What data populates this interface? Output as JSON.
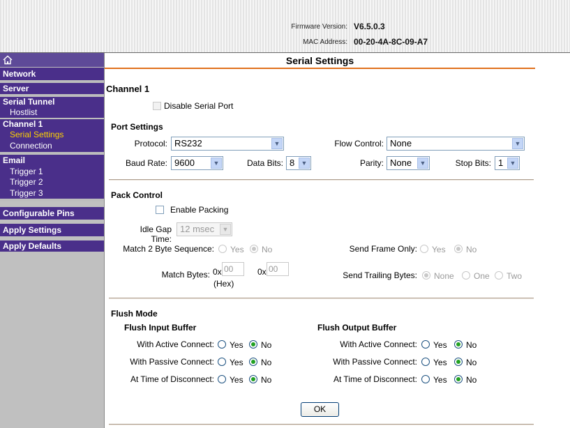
{
  "header": {
    "firmware_label": "Firmware Version:",
    "firmware_value": "V6.5.0.3",
    "mac_label": "MAC Address:",
    "mac_value": "00-20-4A-8C-09-A7"
  },
  "sidebar": {
    "home_icon": "home-icon",
    "items": {
      "network": "Network",
      "server": "Server",
      "serial_tunnel": "Serial Tunnel",
      "hostlist": "Hostlist",
      "channel1": "Channel 1",
      "serial_settings": "Serial Settings",
      "connection": "Connection",
      "email": "Email",
      "trigger1": "Trigger 1",
      "trigger2": "Trigger 2",
      "trigger3": "Trigger 3",
      "configurable_pins": "Configurable Pins",
      "apply_settings": "Apply Settings",
      "apply_defaults": "Apply Defaults"
    },
    "colors": {
      "bg": "#4a2f8a",
      "active": "#ffd200"
    }
  },
  "main": {
    "title": "Serial Settings",
    "channel": "Channel 1",
    "disable_serial_port": "Disable Serial Port",
    "port_settings": {
      "heading": "Port Settings",
      "protocol_label": "Protocol:",
      "protocol_value": "RS232",
      "flow_control_label": "Flow Control:",
      "flow_control_value": "None",
      "baud_rate_label": "Baud Rate:",
      "baud_rate_value": "9600",
      "data_bits_label": "Data Bits:",
      "data_bits_value": "8",
      "parity_label": "Parity:",
      "parity_value": "None",
      "stop_bits_label": "Stop Bits:",
      "stop_bits_value": "1"
    },
    "pack_control": {
      "heading": "Pack Control",
      "enable_packing": "Enable Packing",
      "idle_gap_label": "Idle Gap Time:",
      "idle_gap_value": "12 msec",
      "match_seq_label": "Match 2 Byte Sequence:",
      "send_frame_label": "Send Frame Only:",
      "match_bytes_label": "Match Bytes:",
      "hex_prefix": "0x",
      "match_byte1": "00",
      "match_byte2": "00",
      "hex_note": "(Hex)",
      "send_trailing_label": "Send Trailing Bytes:",
      "opt_yes": "Yes",
      "opt_no": "No",
      "opt_none": "None",
      "opt_one": "One",
      "opt_two": "Two"
    },
    "flush_mode": {
      "heading": "Flush Mode",
      "input_heading": "Flush Input Buffer",
      "output_heading": "Flush Output Buffer",
      "active": "With Active Connect:",
      "passive": "With Passive Connect:",
      "disconnect": "At Time of Disconnect:",
      "yes": "Yes",
      "no": "No"
    },
    "ok_button": "OK"
  },
  "accent_color": "#e0701c"
}
